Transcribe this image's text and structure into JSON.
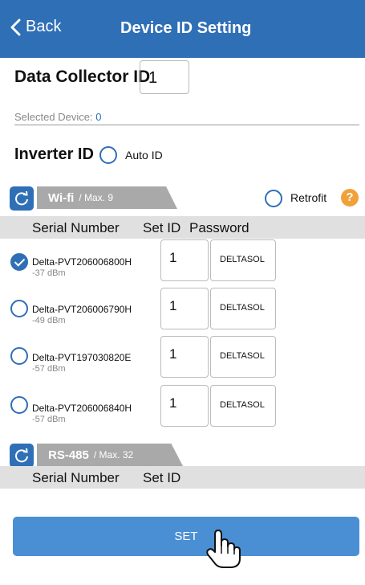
{
  "nav": {
    "back_label": "Back",
    "title": "Device ID Setting"
  },
  "collector": {
    "label": "Data Collector ID",
    "value": "1"
  },
  "selected_device": {
    "label": "Selected Device:",
    "value": "0"
  },
  "inverter": {
    "label": "Inverter ID",
    "auto_label": "Auto ID"
  },
  "wifi": {
    "tab_name": "Wi-fi",
    "tab_max": "/ Max. 9",
    "retrofit_label": "Retrofit",
    "help_glyph": "?",
    "headers": {
      "serial": "Serial Number",
      "set_id": "Set ID",
      "password": "Password"
    },
    "devices": [
      {
        "name": "Delta-PVT206006800H",
        "signal": "-37 dBm",
        "id": "1",
        "password": "DELTASOL",
        "checked": true
      },
      {
        "name": "Delta-PVT206006790H",
        "signal": "-49 dBm",
        "id": "1",
        "password": "DELTASOL",
        "checked": false
      },
      {
        "name": "Delta-PVT197030820E",
        "signal": "-57 dBm",
        "id": "1",
        "password": "DELTASOL",
        "checked": false
      },
      {
        "name": "Delta-PVT206006840H",
        "signal": "-57 dBm",
        "id": "1",
        "password": "DELTASOL",
        "checked": false
      }
    ]
  },
  "rs485": {
    "tab_name": "RS-485",
    "tab_max": "/ Max. 32",
    "headers": {
      "serial": "Serial Number",
      "set_id": "Set ID"
    }
  },
  "set_button": {
    "label": "SET"
  },
  "colors": {
    "primary": "#2f6fb6",
    "button": "#4a8fd4",
    "tab": "#a9a9a9",
    "help": "#f0a13a"
  },
  "icons": [
    "chevron-left-icon",
    "refresh-icon",
    "help-icon",
    "checkmark-icon",
    "hand-pointer-icon"
  ]
}
